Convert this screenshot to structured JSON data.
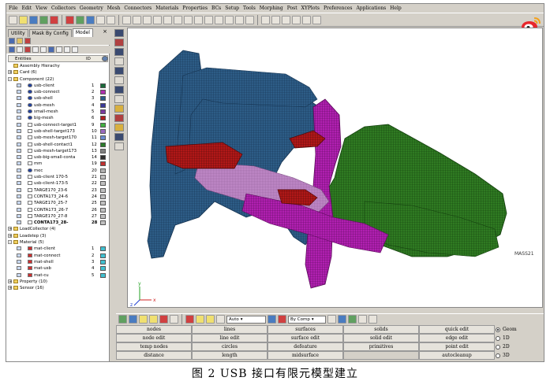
{
  "menu": [
    "File",
    "Edit",
    "View",
    "Collectors",
    "Geometry",
    "Mesh",
    "Connectors",
    "Materials",
    "Properties",
    "BCs",
    "Setup",
    "Tools",
    "Morphing",
    "Post",
    "XYPlots",
    "Preferences",
    "Applications",
    "Help"
  ],
  "tabs": [
    "Utility",
    "Mask By Config",
    "Model"
  ],
  "tab_close": "×",
  "entity_header": {
    "entities": "Entities",
    "id": "ID"
  },
  "tree": [
    {
      "indent": 0,
      "exp": "",
      "icon": "fold",
      "label": "Assembly Hierachy",
      "id": "",
      "color": ""
    },
    {
      "indent": 0,
      "exp": "+",
      "icon": "fold",
      "label": "Card (6)",
      "id": "",
      "color": ""
    },
    {
      "indent": 0,
      "exp": "-",
      "icon": "fold",
      "label": "Component (22)",
      "id": "",
      "color": ""
    },
    {
      "indent": 2,
      "exp": "",
      "icon": "comp",
      "label": "usb-client",
      "id": "1",
      "color": "#1a6a3a"
    },
    {
      "indent": 2,
      "exp": "",
      "icon": "comp",
      "label": "usb-connect",
      "id": "2",
      "color": "#b030b0"
    },
    {
      "indent": 2,
      "exp": "",
      "icon": "comp",
      "label": "usb-shell",
      "id": "3",
      "color": "#2a5c8a"
    },
    {
      "indent": 2,
      "exp": "",
      "icon": "comp",
      "label": "usb-mesh",
      "id": "4",
      "color": "#3a3a9a"
    },
    {
      "indent": 2,
      "exp": "",
      "icon": "comp",
      "label": "small-mesh",
      "id": "5",
      "color": "#7a3aa0"
    },
    {
      "indent": 2,
      "exp": "",
      "icon": "comp",
      "label": "big-mesh",
      "id": "6",
      "color": "#b02020"
    },
    {
      "indent": 2,
      "exp": "",
      "icon": "",
      "label": "usb-connect-target1",
      "id": "9",
      "color": "#40b040"
    },
    {
      "indent": 2,
      "exp": "",
      "icon": "",
      "label": "usb-shell-target173",
      "id": "10",
      "color": "#9a6ac0"
    },
    {
      "indent": 2,
      "exp": "",
      "icon": "",
      "label": "usb-mesh-target170",
      "id": "11",
      "color": "#6a8ad0"
    },
    {
      "indent": 2,
      "exp": "",
      "icon": "",
      "label": "usb-shell-contact1",
      "id": "12",
      "color": "#2a7a2a"
    },
    {
      "indent": 2,
      "exp": "",
      "icon": "",
      "label": "usb-mesh-target173",
      "id": "13",
      "color": "#808080"
    },
    {
      "indent": 2,
      "exp": "",
      "icon": "",
      "label": "usb-big-small-conta",
      "id": "14",
      "color": "#303030"
    },
    {
      "indent": 2,
      "exp": "",
      "icon": "",
      "label": "mm",
      "id": "19",
      "color": "#c03030"
    },
    {
      "indent": 2,
      "exp": "",
      "icon": "comp",
      "label": "mec",
      "id": "20",
      "color": "#b0b0b0"
    },
    {
      "indent": 2,
      "exp": "",
      "icon": "",
      "label": "usb-client 170-5",
      "id": "21",
      "color": "#c0c0c0"
    },
    {
      "indent": 2,
      "exp": "",
      "icon": "",
      "label": "usb-client-173-5",
      "id": "22",
      "color": "#c0c0c0"
    },
    {
      "indent": 2,
      "exp": "",
      "icon": "",
      "label": "TARGE170_23-6",
      "id": "23",
      "color": "#c0c0c0"
    },
    {
      "indent": 2,
      "exp": "",
      "icon": "",
      "label": "CONTA173_24-6",
      "id": "24",
      "color": "#c0c0c0"
    },
    {
      "indent": 2,
      "exp": "",
      "icon": "",
      "label": "TARGE170_25-7",
      "id": "25",
      "color": "#c0c0c0"
    },
    {
      "indent": 2,
      "exp": "",
      "icon": "",
      "label": "CONTA173_26-7",
      "id": "26",
      "color": "#c0c0c0"
    },
    {
      "indent": 2,
      "exp": "",
      "icon": "",
      "label": "TARGE170_27-8",
      "id": "27",
      "color": "#c0c0c0"
    },
    {
      "indent": 2,
      "exp": "",
      "icon": "",
      "label": "CONTA173_28-",
      "id": "28",
      "color": "#c0c0c0",
      "bold": true
    },
    {
      "indent": 0,
      "exp": "+",
      "icon": "fold",
      "label": "LoadCollector (4)",
      "id": "",
      "color": ""
    },
    {
      "indent": 0,
      "exp": "+",
      "icon": "fold",
      "label": "Loadstep (3)",
      "id": "",
      "color": ""
    },
    {
      "indent": 0,
      "exp": "-",
      "icon": "fold",
      "label": "Material (5)",
      "id": "",
      "color": ""
    },
    {
      "indent": 2,
      "exp": "",
      "icon": "mat",
      "label": "mat-client",
      "id": "1",
      "color": "#40c0d0"
    },
    {
      "indent": 2,
      "exp": "",
      "icon": "mat",
      "label": "mat-connect",
      "id": "2",
      "color": "#40c0d0"
    },
    {
      "indent": 2,
      "exp": "",
      "icon": "mat",
      "label": "mat-shell",
      "id": "3",
      "color": "#40c0d0"
    },
    {
      "indent": 2,
      "exp": "",
      "icon": "mat",
      "label": "mat-usb",
      "id": "4",
      "color": "#40c0d0"
    },
    {
      "indent": 2,
      "exp": "",
      "icon": "mat",
      "label": "mat-cu",
      "id": "5",
      "color": "#40c0d0"
    },
    {
      "indent": 0,
      "exp": "+",
      "icon": "fold",
      "label": "Property (10)",
      "id": "",
      "color": ""
    },
    {
      "indent": 0,
      "exp": "+",
      "icon": "fold",
      "label": "Sensor (16)",
      "id": "",
      "color": ""
    }
  ],
  "viewport_label": "MASS21",
  "axis_labels": {
    "x": "x",
    "y": "y",
    "z": "z"
  },
  "bottom": {
    "auto": "Auto",
    "bycomp": "By Comp"
  },
  "grid": [
    [
      "nodes",
      "lines",
      "surfaces",
      "solids",
      "quick edit"
    ],
    [
      "node edit",
      "line edit",
      "surface edit",
      "solid edit",
      "edge edit"
    ],
    [
      "temp nodes",
      "circles",
      "defeature",
      "primitives",
      "point edit"
    ],
    [
      "distance",
      "length",
      "midsurface",
      "",
      "autocleanup"
    ]
  ],
  "radios": [
    {
      "label": "Geom",
      "on": true
    },
    {
      "label": "1D",
      "on": false
    },
    {
      "label": "2D",
      "on": false
    },
    {
      "label": "3D",
      "on": false
    }
  ],
  "caption": "图 2   USB 接口有限元模型建立",
  "colors": {
    "shell": "#2d5c86",
    "client": "#2f7a22",
    "connect": "#b020b0",
    "bigmesh": "#b01818"
  }
}
